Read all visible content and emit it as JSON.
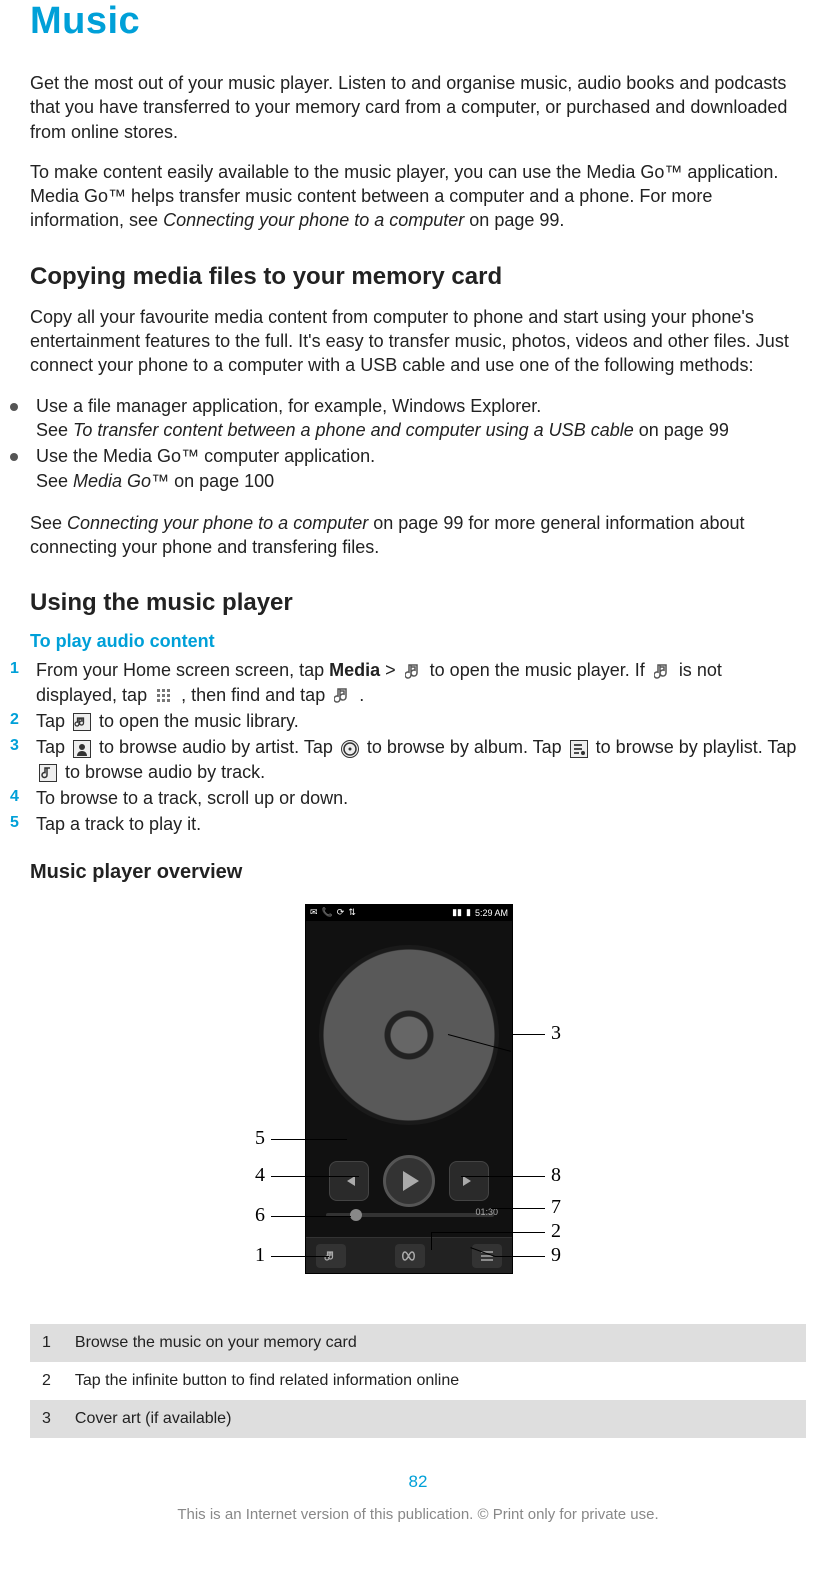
{
  "title": "Music",
  "intro_p1": "Get the most out of your music player. Listen to and organise music, audio books and podcasts that you have transferred to your memory card from a computer, or purchased and downloaded from online stores.",
  "intro_p2_a": "To make content easily available to the music player, you can use the Media Go™ application. Media Go™ helps transfer music content between a computer and a phone. For more information, see ",
  "intro_p2_ref": "Connecting your phone to a computer",
  "intro_p2_b": " on page 99.",
  "section1_heading": "Copying media files to your memory card",
  "section1_p": "Copy all your favourite media content from computer to phone and start using your phone's entertainment features to the full. It's easy to transfer music, photos, videos and other files. Just connect your phone to a computer with a USB cable and use one of the following methods:",
  "bullets": {
    "b1_line1": "Use a file manager application, for example, Windows Explorer.",
    "b1_line2a": "See ",
    "b1_line2_ref": "To transfer content between a phone and computer using a USB cable",
    "b1_line2b": " on page 99",
    "b2_line1": "Use the Media Go™ computer application.",
    "b2_line2a": "See ",
    "b2_line2_ref": "Media Go™",
    "b2_line2b": " on page 100"
  },
  "section1_after_a": "See ",
  "section1_after_ref": "Connecting your phone to a computer",
  "section1_after_b": " on page 99 for more general information about connecting your phone and transfering files.",
  "section2_heading": "Using the music player",
  "play_audio_heading": "To play audio content",
  "steps": {
    "s1a": "From your Home screen screen, tap ",
    "s1_bold": "Media",
    "s1b": " > ",
    "s1c": " to open the music player. If ",
    "s1d": " is not displayed, tap ",
    "s1e": ", then find and tap ",
    "s1f": ".",
    "s2a": "Tap ",
    "s2b": " to open the music library.",
    "s3a": "Tap ",
    "s3b": " to browse audio by artist. Tap ",
    "s3c": " to browse by album. Tap ",
    "s3d": " to browse by playlist. Tap ",
    "s3e": " to browse audio by track.",
    "s4": "To browse to a track, scroll up or down.",
    "s5": "Tap a track to play it."
  },
  "step_markers": {
    "m1": "1",
    "m2": "2",
    "m3": "3",
    "m4": "4",
    "m5": "5"
  },
  "overview_heading": "Music player overview",
  "phone": {
    "time": "5:29 AM",
    "prog_time": "01:30"
  },
  "callouts": {
    "c1": "1",
    "c2": "2",
    "c3": "3",
    "c4": "4",
    "c5": "5",
    "c6": "6",
    "c7": "7",
    "c8": "8",
    "c9": "9"
  },
  "legend": {
    "r1_num": "1",
    "r1_text": "Browse the music on your memory card",
    "r2_num": "2",
    "r2_text": "Tap the infinite button to find related information online",
    "r3_num": "3",
    "r3_text": "Cover art (if available)"
  },
  "page_number": "82",
  "footer": "This is an Internet version of this publication. © Print only for private use."
}
